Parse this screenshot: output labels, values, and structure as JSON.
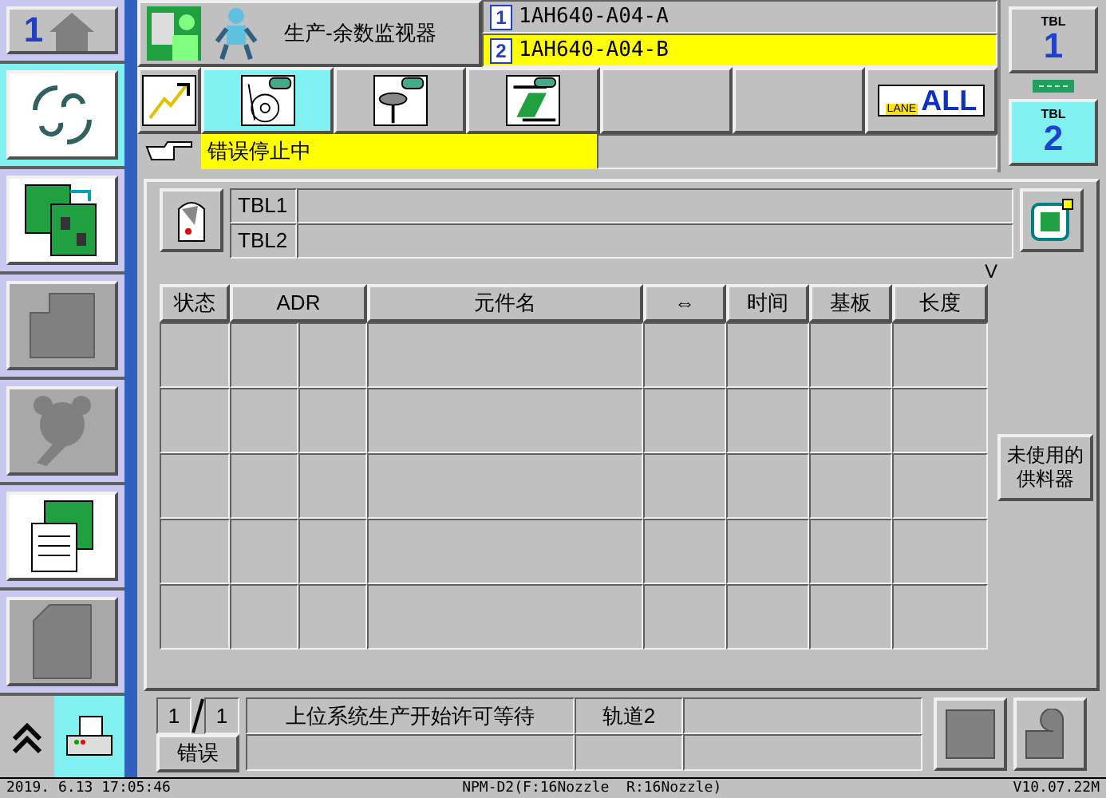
{
  "sidebar": {
    "items": [
      {
        "kind": "home",
        "label": "1",
        "selected": false
      },
      {
        "kind": "swap",
        "selected": true
      },
      {
        "kind": "boards",
        "selected": false
      },
      {
        "kind": "block",
        "selected": false
      },
      {
        "kind": "gear",
        "selected": false
      },
      {
        "kind": "board-doc",
        "selected": false
      },
      {
        "kind": "page",
        "selected": false
      }
    ]
  },
  "header": {
    "title": "生产-余数监视器",
    "lanes": [
      {
        "num": "1",
        "name": "1AH640-A04-A",
        "selected": false
      },
      {
        "num": "2",
        "name": "1AH640-A04-B",
        "selected": true
      }
    ]
  },
  "tabs": [
    {
      "kind": "graph",
      "selected": false
    },
    {
      "kind": "reel",
      "selected": true
    },
    {
      "kind": "nozzle",
      "selected": false
    },
    {
      "kind": "lane",
      "selected": false
    },
    {
      "kind": "empty",
      "selected": false
    },
    {
      "kind": "empty",
      "selected": false
    },
    {
      "kind": "all",
      "label": "ALL",
      "sublabel": "LANE",
      "selected": false
    }
  ],
  "message": "错误停止中",
  "tables": [
    {
      "label": "TBL",
      "num": "1",
      "selected": false
    },
    {
      "label": "TBL",
      "num": "2",
      "selected": true
    }
  ],
  "panel": {
    "tbl_rows": [
      "TBL1",
      "TBL2"
    ],
    "sort_mark": "V",
    "columns": [
      "状态",
      "ADR",
      "元件名",
      "⇔",
      "时间",
      "基板",
      "长度"
    ],
    "side_button": "未使用的供料器"
  },
  "bottom": {
    "page": "1",
    "pages": "1",
    "info": "上位系统生产开始许可等待",
    "lane": "轨道2",
    "error_button": "错误"
  },
  "status_bar": {
    "datetime": "2019. 6.13 17:05:46",
    "model": "NPM-D2(F:16Nozzle  R:16Nozzle)",
    "version": "V10.07.22M"
  }
}
